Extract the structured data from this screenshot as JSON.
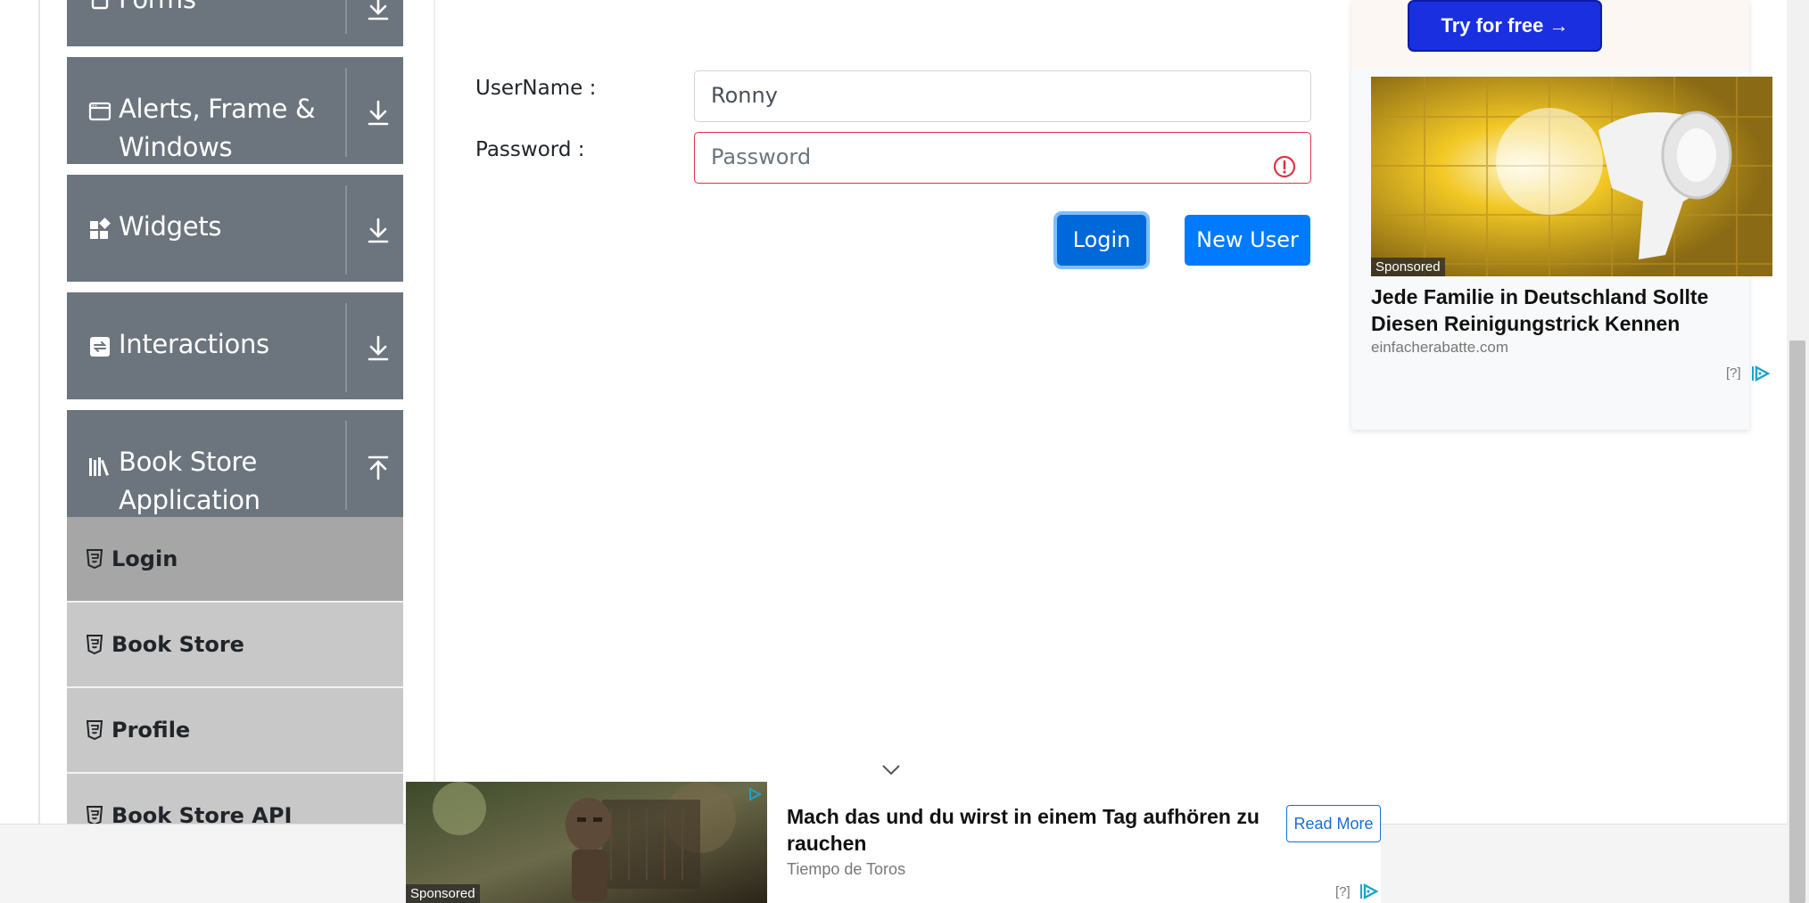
{
  "sidebar": {
    "groups": [
      {
        "label": "Forms"
      },
      {
        "label": "Alerts, Frame & Windows"
      },
      {
        "label": "Widgets"
      },
      {
        "label": "Interactions"
      },
      {
        "label": "Book Store Application"
      }
    ],
    "bookstore_items": [
      {
        "label": "Login"
      },
      {
        "label": "Book Store"
      },
      {
        "label": "Profile"
      },
      {
        "label": "Book Store API"
      }
    ]
  },
  "form": {
    "username_label": "UserName :",
    "username_value": "Ronny",
    "password_label": "Password :",
    "password_placeholder": "Password",
    "login_button": "Login",
    "new_user_button": "New User"
  },
  "ad_right": {
    "cta": "Try for free →",
    "sponsored": "Sponsored",
    "title": "Jede Familie in Deutschland Sollte Diesen Reinigungstrick Kennen",
    "domain": "einfacherabatte.com",
    "info": "[?]"
  },
  "ad_bottom": {
    "sponsored": "Sponsored",
    "title": "Mach das und du wirst in einem Tag aufhören zu rauchen",
    "domain": "Tiempo de Toros",
    "cta": "Read More",
    "info": "[?]"
  },
  "colors": {
    "sidebar_group": "#6c757d",
    "sub_active": "#a6a6a6",
    "sub_item": "#c8c8c8",
    "primary": "#007bff",
    "invalid": "#dc3545"
  }
}
